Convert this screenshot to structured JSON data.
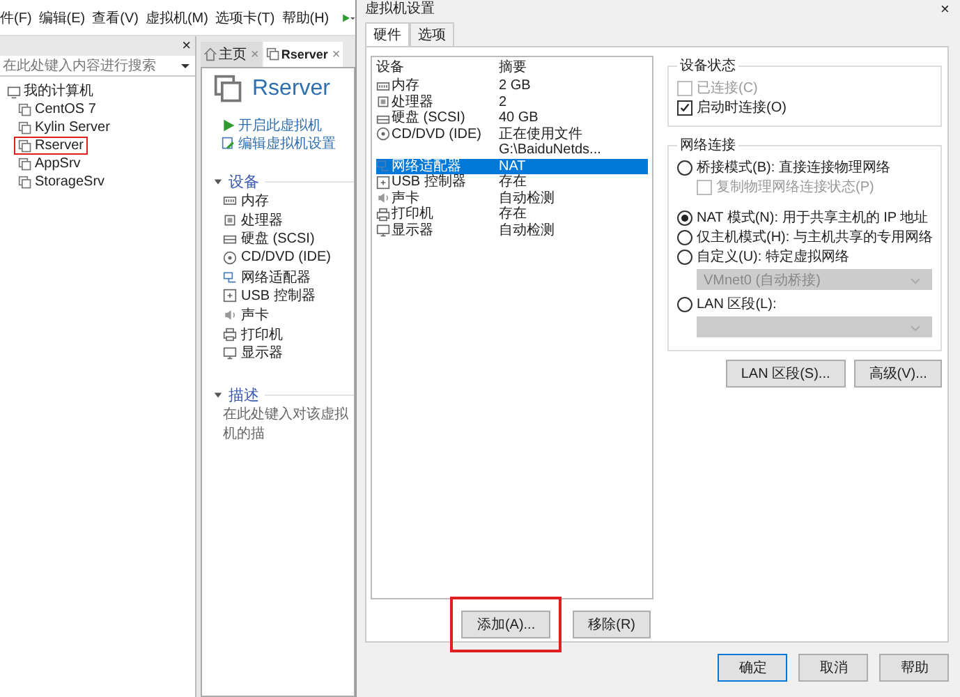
{
  "menu": [
    "件(F)",
    "编辑(E)",
    "查看(V)",
    "虚拟机(M)",
    "选项卡(T)",
    "帮助(H)"
  ],
  "library": {
    "close": "×",
    "search": {
      "placeholder": "在此处键入内容进行搜索"
    },
    "tree": [
      {
        "label": "我的计算机",
        "marked": false,
        "children": [
          {
            "label": "CentOS 7",
            "marked": false
          },
          {
            "label": "Kylin Server",
            "marked": false
          },
          {
            "label": "Rserver",
            "marked": true
          },
          {
            "label": "AppSrv",
            "marked": false
          },
          {
            "label": "StorageSrv",
            "marked": false
          }
        ]
      }
    ]
  },
  "vm_tabs": [
    {
      "label": "主页",
      "kind": "home",
      "selected": false,
      "close": "×"
    },
    {
      "label": "Rserver",
      "kind": "vm",
      "selected": true,
      "close": "×"
    }
  ],
  "vm": {
    "title": "Rserver",
    "actions": [
      {
        "label": "开启此虚拟机",
        "kind": "play"
      },
      {
        "label": "编辑虚拟机设置",
        "kind": "edit"
      }
    ],
    "devices_heading": "设备",
    "devices": [
      {
        "label": "内存",
        "kind": "memory"
      },
      {
        "label": "处理器",
        "kind": "cpu"
      },
      {
        "label": "硬盘 (SCSI)",
        "kind": "disk"
      },
      {
        "label": "CD/DVD (IDE)",
        "kind": "cdrom"
      },
      {
        "label": "网络适配器",
        "kind": "network"
      },
      {
        "label": "USB 控制器",
        "kind": "usb"
      },
      {
        "label": "声卡",
        "kind": "sound"
      },
      {
        "label": "打印机",
        "kind": "printer"
      },
      {
        "label": "显示器",
        "kind": "display"
      }
    ],
    "description_heading": "描述",
    "description_placeholder": "在此处键入对该虚拟机的描"
  },
  "dialog": {
    "title": "虚拟机设置",
    "close": "×",
    "tabs": [
      {
        "label": "硬件",
        "selected": true
      },
      {
        "label": "选项",
        "selected": false
      }
    ],
    "columns": [
      "设备",
      "摘要"
    ],
    "rows": [
      {
        "device": "内存",
        "summary": "2 GB",
        "kind": "memory",
        "selected": false
      },
      {
        "device": "处理器",
        "summary": "2",
        "kind": "cpu",
        "selected": false
      },
      {
        "device": "硬盘 (SCSI)",
        "summary": "40 GB",
        "kind": "disk",
        "selected": false
      },
      {
        "device": "CD/DVD (IDE)",
        "summary": "正在使用文件 G:\\BaiduNetds...",
        "kind": "cdrom",
        "selected": false
      },
      {
        "device": "网络适配器",
        "summary": "NAT",
        "kind": "network",
        "selected": true
      },
      {
        "device": "USB 控制器",
        "summary": "存在",
        "kind": "usb",
        "selected": false
      },
      {
        "device": "声卡",
        "summary": "自动检测",
        "kind": "sound",
        "selected": false
      },
      {
        "device": "打印机",
        "summary": "存在",
        "kind": "printer",
        "selected": false
      },
      {
        "device": "显示器",
        "summary": "自动检测",
        "kind": "display",
        "selected": false
      }
    ],
    "list_buttons": [
      {
        "label": "添加(A)...",
        "marked": true
      },
      {
        "label": "移除(R)",
        "marked": false
      }
    ],
    "device_status": {
      "title": "设备状态",
      "options": [
        {
          "label": "已连接(C)",
          "checked": false,
          "disabled": true
        },
        {
          "label": "启动时连接(O)",
          "checked": true,
          "disabled": false
        }
      ]
    },
    "network": {
      "title": "网络连接",
      "options": [
        {
          "kind": "radio",
          "label": "桥接模式(B): 直接连接物理网络",
          "selected": false
        },
        {
          "kind": "checkbox",
          "label": "复制物理网络连接状态(P)",
          "checked": false,
          "disabled": true
        },
        {
          "kind": "radio",
          "label": "NAT 模式(N): 用于共享主机的 IP 地址",
          "selected": true
        },
        {
          "kind": "radio",
          "label": "仅主机模式(H): 与主机共享的专用网络",
          "selected": false
        },
        {
          "kind": "radio",
          "label": "自定义(U): 特定虚拟网络",
          "selected": false
        },
        {
          "kind": "select",
          "value": "VMnet0 (自动桥接)",
          "disabled": true
        },
        {
          "kind": "radio",
          "label": "LAN 区段(L):",
          "selected": false
        },
        {
          "kind": "select",
          "disabled": true
        }
      ]
    },
    "side_buttons": [
      "LAN 区段(S)...",
      "高级(V)..."
    ],
    "footer_buttons": [
      {
        "label": "确定",
        "default": true
      },
      {
        "label": "取消",
        "default": false
      },
      {
        "label": "帮助",
        "default": false
      }
    ]
  }
}
